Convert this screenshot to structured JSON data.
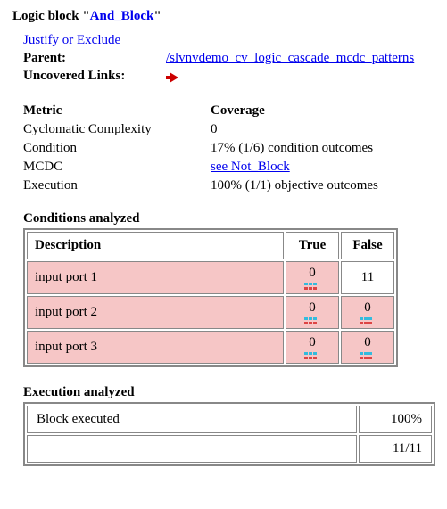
{
  "title_prefix": "Logic block \"",
  "title_link": "And_Block",
  "title_suffix": "\"",
  "links": {
    "justify": "Justify or Exclude"
  },
  "info": {
    "parent_label": "Parent:",
    "parent_link": "/slvnvdemo_cv_logic_cascade_mcdc_patterns",
    "uncovered_label": "Uncovered Links:"
  },
  "metrics": {
    "header_metric": "Metric",
    "header_cov": "Coverage",
    "rows": [
      {
        "name": "Cyclomatic Complexity",
        "value": "0"
      },
      {
        "name": "Condition",
        "value": "17% (1/6) condition outcomes"
      },
      {
        "name": "MCDC",
        "value_link": "see Not_Block"
      },
      {
        "name": "Execution",
        "value": "100% (1/1) objective outcomes"
      }
    ]
  },
  "conditions": {
    "title": "Conditions analyzed",
    "headers": {
      "desc": "Description",
      "t": "True",
      "f": "False"
    },
    "rows": [
      {
        "desc": "input port 1",
        "t": "0",
        "f": "11"
      },
      {
        "desc": "input port 2",
        "t": "0",
        "f": "0"
      },
      {
        "desc": "input port 3",
        "t": "0",
        "f": "0"
      }
    ]
  },
  "execution": {
    "title": "Execution analyzed",
    "row1": {
      "label": "Block executed",
      "value": "100%"
    },
    "row2": {
      "value": "11/11"
    }
  }
}
